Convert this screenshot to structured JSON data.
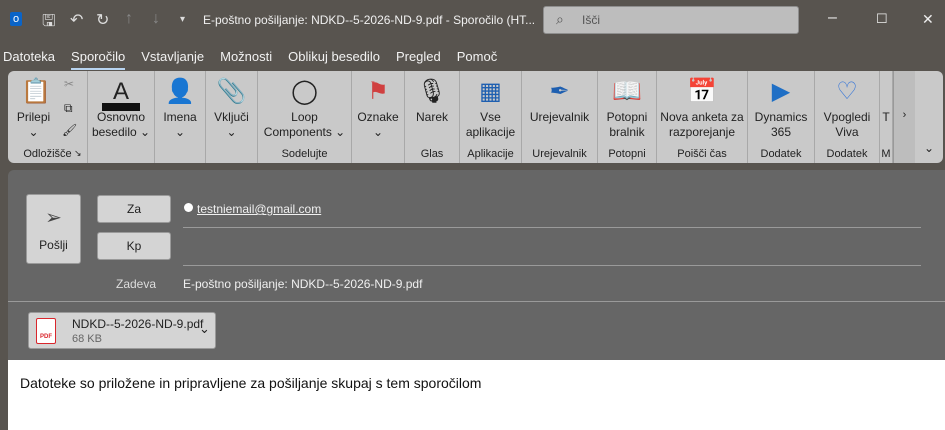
{
  "titlebar": {
    "title": "E-poštno pošiljanje: NDKD--5-2026-ND-9.pdf  -  Sporočilo (HT...",
    "search_placeholder": "Išči",
    "icons": [
      "outlook-icon",
      "save-icon",
      "undo-icon",
      "redo-icon",
      "up-arrow-icon",
      "down-arrow-icon",
      "customize-icon"
    ]
  },
  "tabs": [
    {
      "label": "Datoteka"
    },
    {
      "label": "Sporočilo",
      "active": true
    },
    {
      "label": "Vstavljanje"
    },
    {
      "label": "Možnosti"
    },
    {
      "label": "Oblikuj besedilo"
    },
    {
      "label": "Pregled"
    },
    {
      "label": "Pomoč"
    }
  ],
  "ribbon": {
    "groups": [
      {
        "label": "Prilepi",
        "sub": "⌄",
        "group": "Odložišče",
        "icon": "paste-icon",
        "glyph": "📋"
      },
      {
        "label": "Osnovno besedilo ⌄",
        "group": "",
        "icon": "font-icon",
        "glyph": "A"
      },
      {
        "label": "Imena",
        "sub": "⌄",
        "group": "",
        "icon": "address-book-icon",
        "glyph": "👤"
      },
      {
        "label": "Vključi",
        "sub": "⌄",
        "group": "",
        "icon": "paperclip-icon",
        "glyph": "📎"
      },
      {
        "label": "Loop Components ⌄",
        "group": "Sodelujte",
        "icon": "loop-icon",
        "glyph": "◯"
      },
      {
        "label": "Oznake",
        "sub": "⌄",
        "group": "",
        "icon": "flag-icon",
        "glyph": "⚑"
      },
      {
        "label": "Narek",
        "group": "Glas",
        "icon": "microphone-icon",
        "glyph": "🎙"
      },
      {
        "label": "Vse aplikacije",
        "group": "Aplikacije",
        "icon": "apps-icon",
        "glyph": "▦"
      },
      {
        "label": "Urejevalnik",
        "group": "Urejevalnik",
        "icon": "editor-icon",
        "glyph": "✒"
      },
      {
        "label": "Potopni bralnik",
        "group": "Potopni",
        "icon": "immersive-reader-icon",
        "glyph": "📖"
      },
      {
        "label": "Nova anketa za razporejanje",
        "group": "Poišči čas",
        "icon": "poll-calendar-icon",
        "glyph": "📅"
      },
      {
        "label": "Dynamics 365",
        "group": "Dodatek",
        "icon": "dynamics-icon",
        "glyph": "▶"
      },
      {
        "label": "Vpogledi Viva",
        "group": "Dodatek",
        "icon": "viva-icon",
        "glyph": "♡"
      },
      {
        "label": "T",
        "group": "M",
        "icon": "more-icon",
        "glyph": ""
      }
    ],
    "scroll": "›",
    "collapse": "⌄"
  },
  "compose": {
    "send_label": "Pošlji",
    "to_label": "Za",
    "cc_label": "Kp",
    "to_value": "testniemail@gmail.com",
    "subject_label": "Zadeva",
    "subject_value": "E-poštno pošiljanje: NDKD--5-2026-ND-9.pdf",
    "attachment": {
      "name": "NDKD--5-2026-ND-9.pdf",
      "size": "68 KB"
    }
  },
  "body": {
    "text": "Datoteke so priložene in pripravljene za pošiljanje skupaj s tem sporočilom"
  },
  "colors": {
    "titlebar": "#58544f",
    "ribbon": "#c9c9c9",
    "compose": "#666666",
    "pdf": "#d9262c"
  }
}
